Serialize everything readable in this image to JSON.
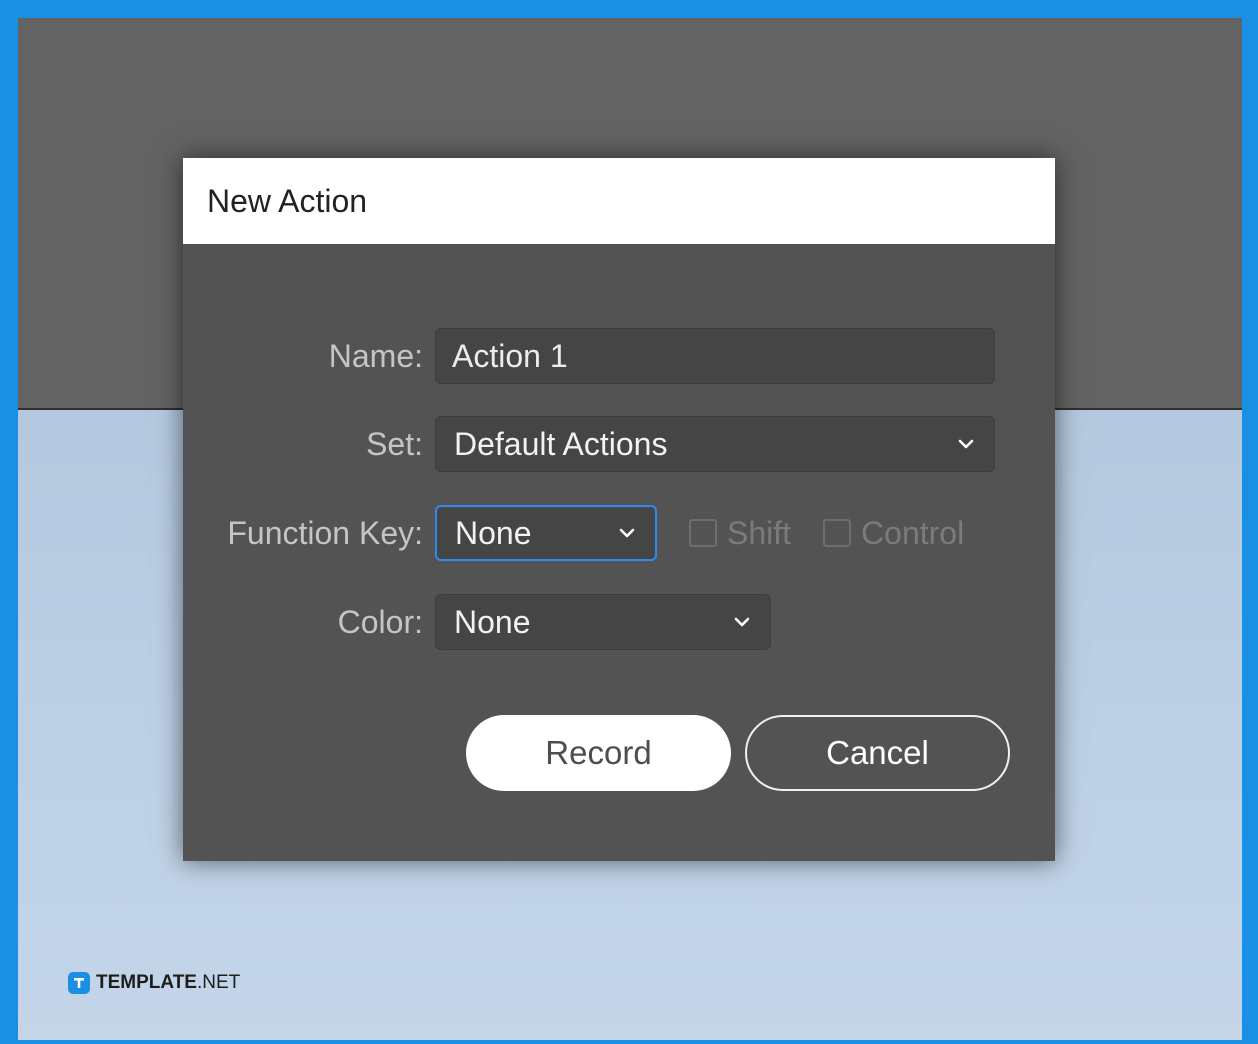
{
  "dialog": {
    "title": "New Action",
    "fields": {
      "name": {
        "label": "Name:",
        "value": "Action 1"
      },
      "set": {
        "label": "Set:",
        "value": "Default Actions"
      },
      "function_key": {
        "label": "Function Key:",
        "value": "None",
        "checkboxes": [
          {
            "label": "Shift",
            "checked": false
          },
          {
            "label": "Control",
            "checked": false
          }
        ]
      },
      "color": {
        "label": "Color:",
        "value": "None"
      }
    },
    "buttons": {
      "record": "Record",
      "cancel": "Cancel"
    }
  },
  "watermark": {
    "brand": "TEMPLATE",
    "suffix": ".NET"
  },
  "colors": {
    "frame": "#1a8fe3",
    "dialog_bg": "#535353",
    "focus_accent": "#2d8ceb",
    "upper_bg": "#636363",
    "lower_bg": "#bdd0e6"
  },
  "icons": {
    "dropdown": "chevron-down-icon",
    "logo": "template-logo-icon"
  }
}
